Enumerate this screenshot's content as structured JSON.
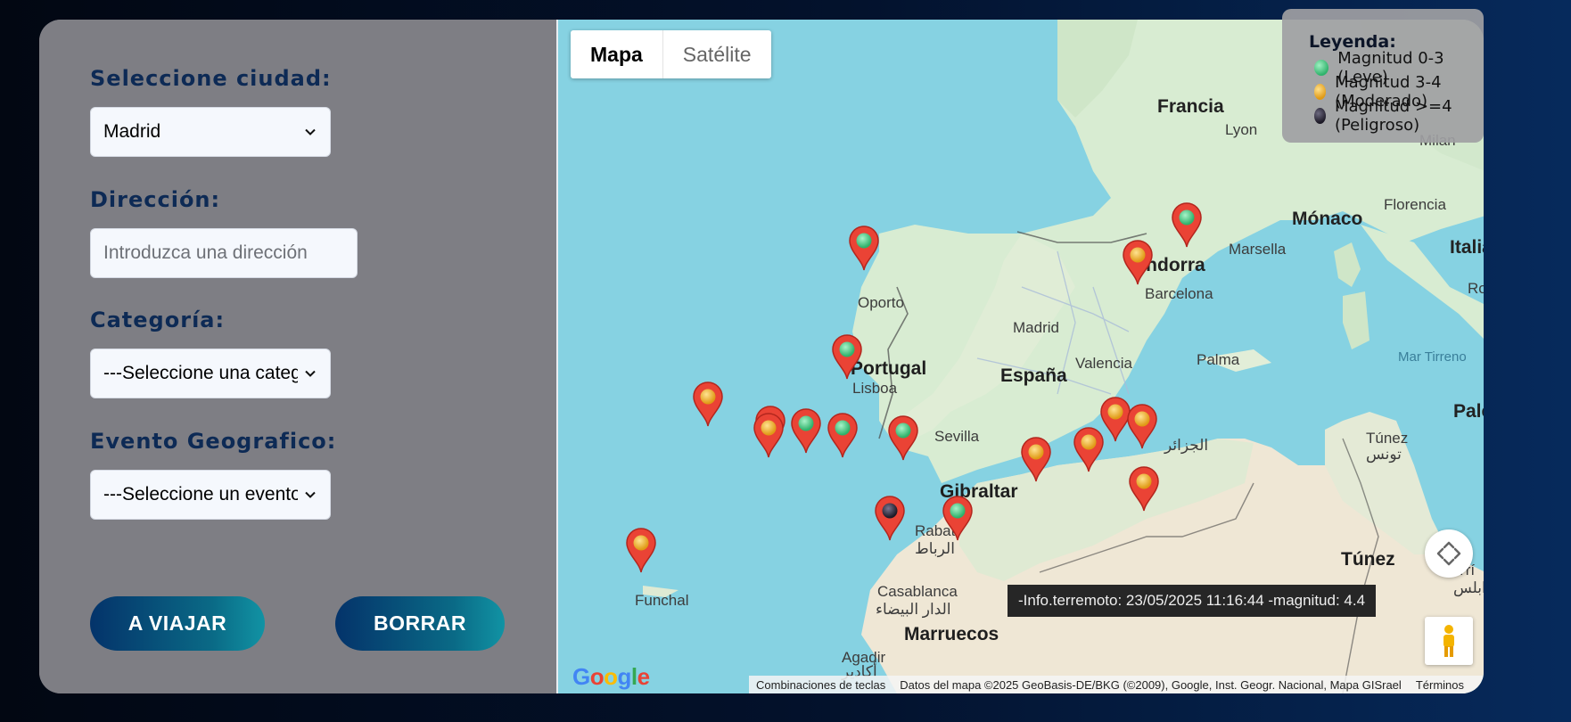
{
  "form": {
    "city_label": "Seleccione ciudad:",
    "city_value": "Madrid",
    "address_label": "Dirección:",
    "address_placeholder": "Introduzca una dirección",
    "category_label": "Categoría:",
    "category_value": "---Seleccione una categoría---",
    "event_label": "Evento Geografico:",
    "event_value": "---Seleccione un evento---",
    "travel_button": "A VIAJAR",
    "clear_button": "BORRAR"
  },
  "map": {
    "type_map": "Mapa",
    "type_satellite": "Satélite",
    "places": {
      "francia": "Francia",
      "lyon": "Lyon",
      "milan": "Milan",
      "monaco": "Mónaco",
      "marsella": "Marsella",
      "florencia": "Florencia",
      "italia": "Italia",
      "roma": "Ro",
      "andorra": "Andorra",
      "barcelona": "Barcelona",
      "oporto": "Oporto",
      "madrid": "Madrid",
      "portugal": "Portugal",
      "lisboa": "Lisboa",
      "espana": "España",
      "valencia": "Valencia",
      "palma": "Palma",
      "mar_tirreno": "Mar Tirreno",
      "palermo": "Pale",
      "sevilla": "Sevilla",
      "gibraltar": "Gibraltar",
      "tunez_city": "Túnez",
      "tunez_ar": "تونس",
      "tunez_country": "Túnez",
      "argel_ar": "الجزائر",
      "rabat": "Rabat",
      "rabat_ar": "الرباط",
      "casablanca": "Casablanca",
      "casablanca_ar": "الدار البيضاء",
      "marruecos": "Marruecos",
      "agadir": "Agadir",
      "agadir_ar": "أكادير",
      "funchal": "Funchal",
      "tripoli": "Trí",
      "tripoli_ar": "طرابلس"
    },
    "tooltip": "-Info.terremoto: 23/05/2025 11:16:44 -magnitud: 4.4",
    "google_logo": "Google",
    "attribution": {
      "shortcuts": "Combinaciones de teclas",
      "data": "Datos del mapa ©2025 GeoBasis-DE/BKG (©2009), Google, Inst. Geogr. Nacional, Mapa GISrael",
      "terms": "Términos"
    }
  },
  "legend": {
    "title": "Leyenda:",
    "items": [
      {
        "label": "Magnitud 0-3 (Leve)",
        "color": "#3ecf7f"
      },
      {
        "label": "Magnitud 3-4 (Moderado)",
        "color": "#f2b630"
      },
      {
        "label": "Magnitud >=4 (Peligroso)",
        "color": "#2c2838"
      }
    ]
  },
  "markers": [
    {
      "level": "leve"
    },
    {
      "level": "leve"
    },
    {
      "level": "moderado"
    },
    {
      "level": "leve"
    },
    {
      "level": "moderado"
    },
    {
      "level": "moderado"
    },
    {
      "level": "moderado"
    },
    {
      "level": "leve"
    },
    {
      "level": "leve"
    },
    {
      "level": "leve"
    },
    {
      "level": "moderado"
    },
    {
      "level": "moderado"
    },
    {
      "level": "moderado"
    },
    {
      "level": "moderado"
    },
    {
      "level": "moderado"
    },
    {
      "level": "peligroso"
    },
    {
      "level": "leve"
    },
    {
      "level": "moderado"
    }
  ]
}
